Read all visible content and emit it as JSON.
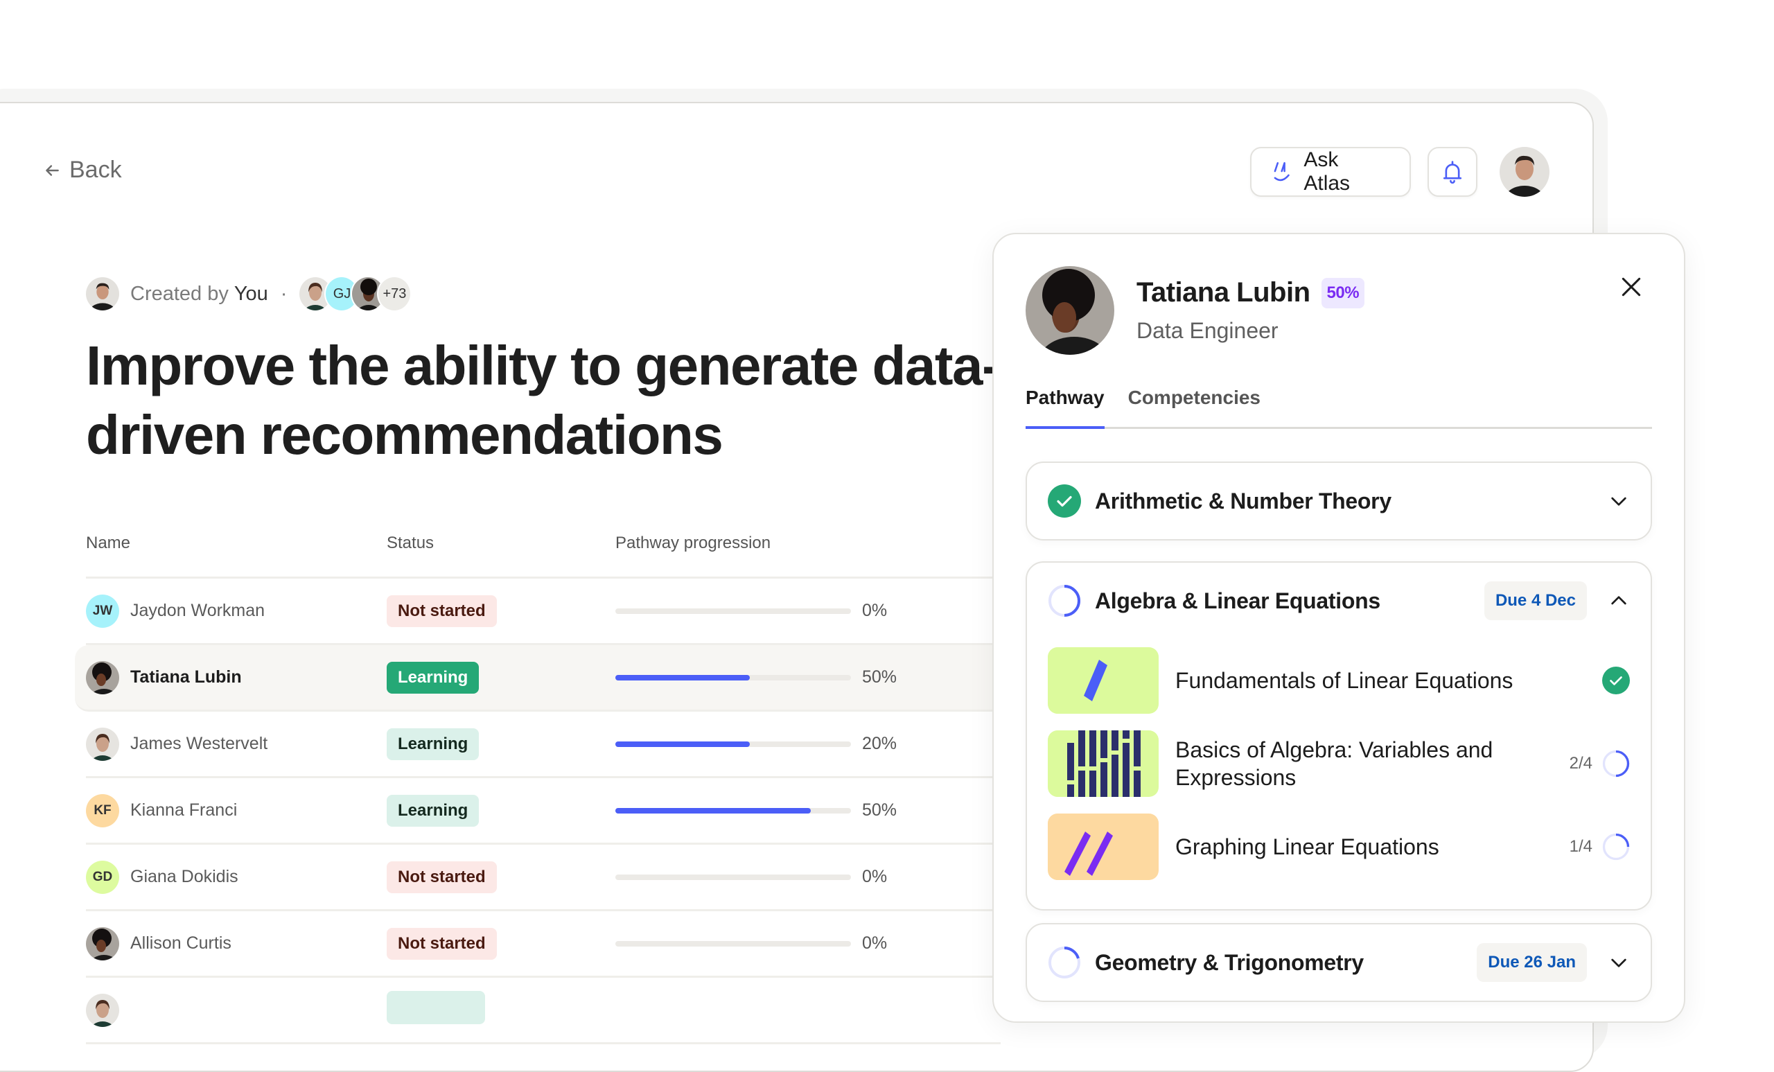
{
  "nav": {
    "back_label": "Back"
  },
  "header": {
    "ask_atlas_label": "Ask Atlas",
    "accent": "#4b5ef7"
  },
  "meta": {
    "created_by_prefix": "Created by",
    "created_by_name": "You",
    "separator": "·",
    "collaborators": [
      {
        "type": "photo",
        "name": "collaborator-1"
      },
      {
        "type": "initials",
        "initials": "GJ",
        "color": "#a6f2fb"
      },
      {
        "type": "photo",
        "name": "collaborator-3"
      }
    ],
    "more_count": "+73"
  },
  "page": {
    "title": "Improve the ability to generate data-driven recommendations"
  },
  "table": {
    "columns": [
      "Name",
      "Status",
      "Pathway progression"
    ],
    "rows": [
      {
        "name": "Jaydon Workman",
        "avatar": {
          "type": "initials",
          "initials": "JW",
          "color": "#a6f2fb"
        },
        "status": "Not started",
        "status_kind": "not",
        "progress_label": "0%",
        "progress_fill": 0,
        "selected": false
      },
      {
        "name": "Tatiana Lubin",
        "avatar": {
          "type": "photo",
          "tone": "dark"
        },
        "status": "Learning",
        "status_kind": "learn",
        "progress_label": "50%",
        "progress_fill": 0.57,
        "selected": true
      },
      {
        "name": "James Westervelt",
        "avatar": {
          "type": "photo",
          "tone": "light"
        },
        "status": "Learning",
        "status_kind": "learn",
        "progress_label": "20%",
        "progress_fill": 0.57,
        "selected": false
      },
      {
        "name": "Kianna Franci",
        "avatar": {
          "type": "initials",
          "initials": "KF",
          "color": "#fdd9a0"
        },
        "status": "Learning",
        "status_kind": "learn",
        "progress_label": "50%",
        "progress_fill": 0.83,
        "selected": false
      },
      {
        "name": "Giana Dokidis",
        "avatar": {
          "type": "initials",
          "initials": "GD",
          "color": "#ddfb9f"
        },
        "status": "Not started",
        "status_kind": "not",
        "progress_label": "0%",
        "progress_fill": 0,
        "selected": false
      },
      {
        "name": "Allison Curtis",
        "avatar": {
          "type": "photo",
          "tone": "dark"
        },
        "status": "Not started",
        "status_kind": "not",
        "progress_label": "0%",
        "progress_fill": 0,
        "selected": false
      },
      {
        "name": "",
        "avatar": {
          "type": "photo",
          "tone": "light"
        },
        "status": "",
        "status_kind": "learn",
        "progress_label": "",
        "progress_fill": null,
        "selected": false
      }
    ]
  },
  "panel": {
    "name": "Tatiana Lubin",
    "progress_badge": "50%",
    "role": "Data Engineer",
    "tabs": [
      {
        "label": "Pathway",
        "active": true
      },
      {
        "label": "Competencies",
        "active": false
      }
    ],
    "sections": [
      {
        "title": "Arithmetic & Number Theory",
        "state": "complete",
        "due": "",
        "expanded": false,
        "progress": 1
      },
      {
        "title": "Algebra & Linear Equations",
        "state": "in-progress",
        "due": "Due 4 Dec",
        "expanded": true,
        "progress": 0.5,
        "lessons": [
          {
            "title": "Fundamentals of Linear Equations",
            "count": "",
            "state": "complete",
            "progress": 1,
            "thumb": "lime-slash"
          },
          {
            "title": "Basics of Algebra: Variables and Expressions",
            "count": "2/4",
            "state": "in-progress",
            "progress": 0.5,
            "thumb": "lime-bars"
          },
          {
            "title": "Graphing Linear Equations",
            "count": "1/4",
            "state": "in-progress",
            "progress": 0.25,
            "thumb": "orange-double-slash"
          }
        ]
      },
      {
        "title": "Geometry & Trigonometry",
        "state": "in-progress",
        "due": "Due 26 Jan",
        "expanded": false,
        "progress": 0.15
      }
    ]
  }
}
